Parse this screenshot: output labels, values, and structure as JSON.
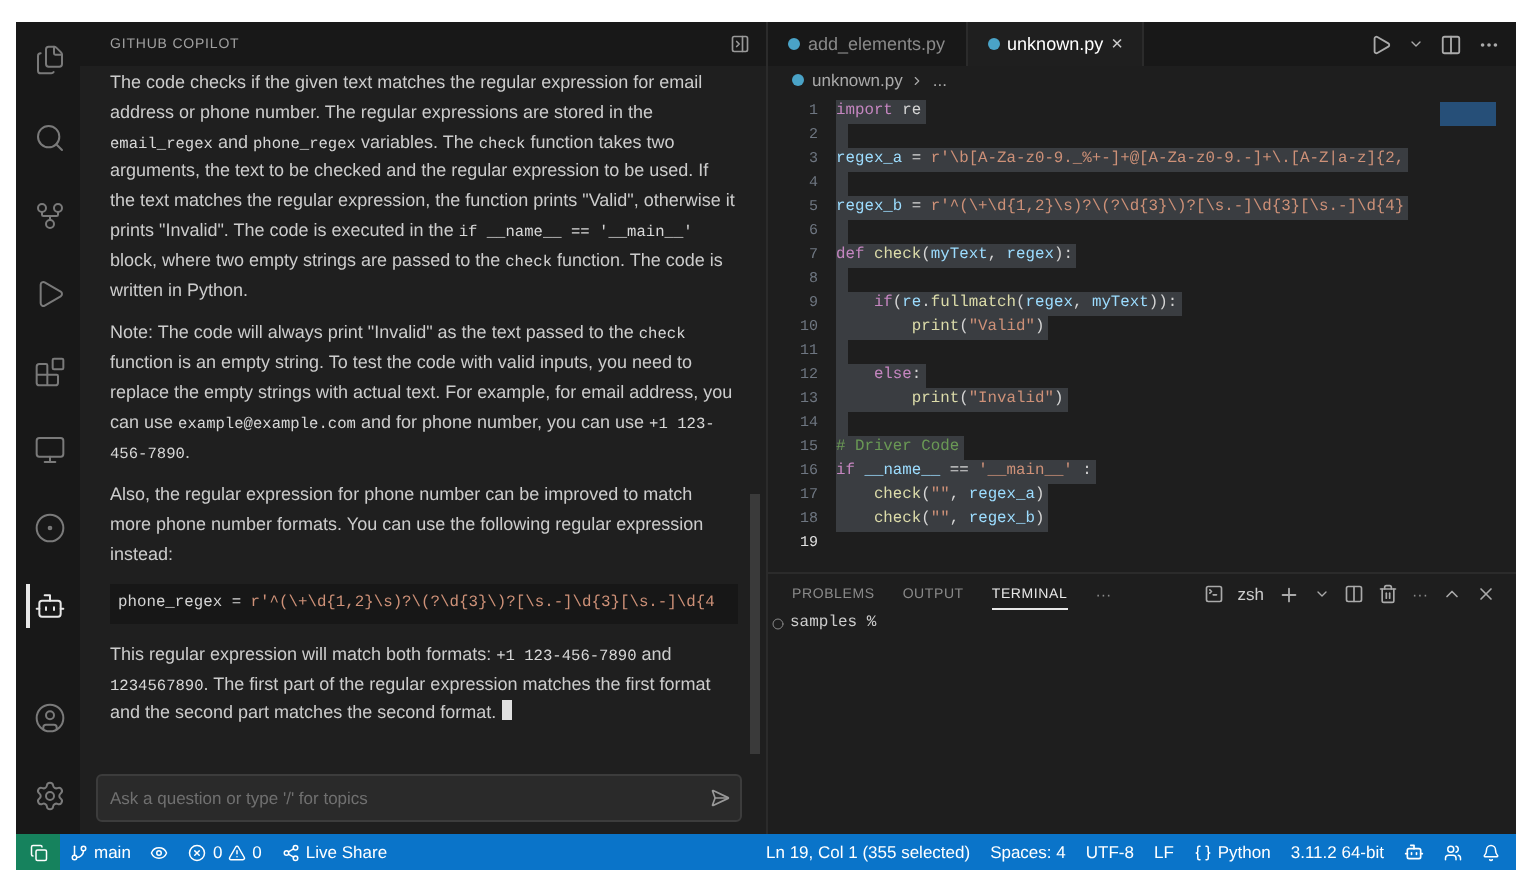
{
  "activity_bar": {
    "items": [
      {
        "kind": "files",
        "selected": false
      },
      {
        "kind": "search",
        "selected": false
      },
      {
        "kind": "source-control",
        "selected": false
      },
      {
        "kind": "run",
        "selected": false
      },
      {
        "kind": "extensions",
        "selected": false
      },
      {
        "kind": "remote",
        "selected": false
      },
      {
        "kind": "copilot",
        "selected": false
      },
      {
        "kind": "chat",
        "selected": true
      }
    ],
    "bottom": [
      {
        "kind": "account"
      },
      {
        "kind": "settings"
      }
    ]
  },
  "chat": {
    "title": "GITHUB COPILOT",
    "paragraphs": [
      {
        "kind": "text",
        "runs": [
          {
            "kind": "text",
            "text": "The code checks if the given text matches the regular expression for email address or phone number. The regular expressions are stored in the "
          },
          {
            "kind": "code",
            "text": "email_regex"
          },
          {
            "kind": "text",
            "text": " and "
          },
          {
            "kind": "code",
            "text": "phone_regex"
          },
          {
            "kind": "text",
            "text": " variables. The "
          },
          {
            "kind": "code",
            "text": "check"
          },
          {
            "kind": "text",
            "text": " function takes two arguments, the text to be checked and the regular expression to be used. If the text matches the regular expression, the function prints \"Valid\", otherwise it prints \"Invalid\". The code is executed in the "
          },
          {
            "kind": "code",
            "text": "if __name__ == '__main__'"
          },
          {
            "kind": "text",
            "text": " block, where two empty strings are passed to the "
          },
          {
            "kind": "code",
            "text": "check"
          },
          {
            "kind": "text",
            "text": " function. The code is written in Python."
          }
        ]
      },
      {
        "kind": "text",
        "runs": [
          {
            "kind": "text",
            "text": "Note: The code will always print \"Invalid\" as the text passed to the "
          },
          {
            "kind": "code",
            "text": "check"
          },
          {
            "kind": "text",
            "text": " function is an empty string. To test the code with valid inputs, you need to replace the empty strings with actual text. For example, for email address, you can use "
          },
          {
            "kind": "code",
            "text": "example@example.com"
          },
          {
            "kind": "text",
            "text": " and for phone number, you can use "
          },
          {
            "kind": "code",
            "text": "+1 123-456-7890"
          },
          {
            "kind": "text",
            "text": "."
          }
        ]
      },
      {
        "kind": "text",
        "runs": [
          {
            "kind": "text",
            "text": "Also, the regular expression for phone number can be improved to match more phone number formats. You can use the following regular expression instead:"
          }
        ]
      },
      {
        "kind": "code",
        "tokens": [
          {
            "kind": "pl",
            "text": "phone_regex = "
          },
          {
            "kind": "str",
            "text": "r'^(\\+\\d{1,2}\\s)?\\(?\\d{3}\\)?[\\s.-]\\d{3}[\\s.-]\\d{4"
          }
        ]
      },
      {
        "kind": "text",
        "cursor": true,
        "runs": [
          {
            "kind": "text",
            "text": "This regular expression will match both formats: "
          },
          {
            "kind": "code",
            "text": "+1 123-456-7890"
          },
          {
            "kind": "text",
            "text": " and "
          },
          {
            "kind": "code",
            "text": "1234567890"
          },
          {
            "kind": "text",
            "text": ". The first part of the regular expression matches the first format and the second part matches the second format."
          }
        ]
      }
    ],
    "input": {
      "placeholder": "Ask a question or type '/' for topics"
    }
  },
  "editor": {
    "tabs": [
      {
        "label": "add_elements.py",
        "selected": false
      },
      {
        "label": "unknown.py",
        "selected": true,
        "close": "×"
      }
    ],
    "breadcrumb": [
      "unknown.py",
      "..."
    ],
    "lines": [
      {
        "number": "1",
        "selected": true,
        "tokens": [
          {
            "kind": "kw",
            "text": "import"
          },
          {
            "kind": "pl",
            "text": " re"
          }
        ]
      },
      {
        "number": "2",
        "selected": true
      },
      {
        "number": "3",
        "selected": true,
        "tokens": [
          {
            "kind": "var",
            "text": "regex_a"
          },
          {
            "kind": "pl",
            "text": " = "
          },
          {
            "kind": "str",
            "text": "r'\\b[A-Za-z0-9._%+-]+@[A-Za-z0-9.-]+\\.[A-Z|a-z]{2,"
          }
        ]
      },
      {
        "number": "4",
        "selected": true
      },
      {
        "number": "5",
        "selected": true,
        "tokens": [
          {
            "kind": "var",
            "text": "regex_b"
          },
          {
            "kind": "pl",
            "text": " = "
          },
          {
            "kind": "str",
            "text": "r'^(\\+\\d{1,2}\\s)?\\(?\\d{3}\\)?[\\s.-]\\d{3}[\\s.-]\\d{4}"
          }
        ]
      },
      {
        "number": "6",
        "selected": true
      },
      {
        "number": "7",
        "selected": true,
        "tokens": [
          {
            "kind": "kw",
            "text": "def "
          },
          {
            "kind": "fn",
            "text": "check"
          },
          {
            "kind": "pl",
            "text": "("
          },
          {
            "kind": "var",
            "text": "myText"
          },
          {
            "kind": "pl",
            "text": ", "
          },
          {
            "kind": "var",
            "text": "regex"
          },
          {
            "kind": "pl",
            "text": "):"
          }
        ]
      },
      {
        "number": "8",
        "selected": true
      },
      {
        "number": "9",
        "selected": true,
        "tokens": [
          {
            "kind": "kw",
            "text": "    if"
          },
          {
            "kind": "pl",
            "text": "("
          },
          {
            "kind": "var",
            "text": "re"
          },
          {
            "kind": "pl",
            "text": "."
          },
          {
            "kind": "fn",
            "text": "fullmatch"
          },
          {
            "kind": "pl",
            "text": "("
          },
          {
            "kind": "var",
            "text": "regex"
          },
          {
            "kind": "pl",
            "text": ", "
          },
          {
            "kind": "var",
            "text": "myText"
          },
          {
            "kind": "pl",
            "text": ")):"
          }
        ]
      },
      {
        "number": "10",
        "selected": true,
        "tokens": [
          {
            "kind": "fn",
            "text": "        print"
          },
          {
            "kind": "pl",
            "text": "("
          },
          {
            "kind": "str",
            "text": "\"Valid\""
          },
          {
            "kind": "pl",
            "text": ")"
          }
        ]
      },
      {
        "number": "11",
        "selected": true
      },
      {
        "number": "12",
        "selected": true,
        "tokens": [
          {
            "kind": "kw",
            "text": "    else"
          },
          {
            "kind": "pl",
            "text": ":"
          }
        ]
      },
      {
        "number": "13",
        "selected": true,
        "tokens": [
          {
            "kind": "fn",
            "text": "        print"
          },
          {
            "kind": "pl",
            "text": "("
          },
          {
            "kind": "str",
            "text": "\"Invalid\""
          },
          {
            "kind": "pl",
            "text": ")"
          }
        ]
      },
      {
        "number": "14",
        "selected": true
      },
      {
        "number": "15",
        "selected": true,
        "tokens": [
          {
            "kind": "cm",
            "text": "# Driver Code"
          }
        ]
      },
      {
        "number": "16",
        "selected": true,
        "tokens": [
          {
            "kind": "kw",
            "text": "if "
          },
          {
            "kind": "var",
            "text": "__name__"
          },
          {
            "kind": "pl",
            "text": " == "
          },
          {
            "kind": "str",
            "text": "'__main__'"
          },
          {
            "kind": "pl",
            "text": " :"
          }
        ]
      },
      {
        "number": "17",
        "selected": true,
        "tokens": [
          {
            "kind": "fn",
            "text": "    check"
          },
          {
            "kind": "pl",
            "text": "("
          },
          {
            "kind": "str",
            "text": "\"\""
          },
          {
            "kind": "pl",
            "text": ", "
          },
          {
            "kind": "var",
            "text": "regex_a"
          },
          {
            "kind": "pl",
            "text": ")"
          }
        ]
      },
      {
        "number": "18",
        "selected": true,
        "tokens": [
          {
            "kind": "fn",
            "text": "    check"
          },
          {
            "kind": "pl",
            "text": "("
          },
          {
            "kind": "str",
            "text": "\"\""
          },
          {
            "kind": "pl",
            "text": ", "
          },
          {
            "kind": "var",
            "text": "regex_b"
          },
          {
            "kind": "pl",
            "text": ")"
          }
        ]
      },
      {
        "number": "19",
        "selected": false
      }
    ]
  },
  "panel": {
    "tabs": [
      {
        "label": "PROBLEMS",
        "selected": false
      },
      {
        "label": "OUTPUT",
        "selected": false
      },
      {
        "label": "TERMINAL",
        "selected": true
      }
    ],
    "more": "···",
    "shell": "zsh",
    "more_actions": "···",
    "terminal_lines": [
      "samples %"
    ]
  },
  "status_bar": {
    "branch": "main",
    "errors": "0",
    "warnings": "0",
    "live_share": "Live Share",
    "right": [
      {
        "kind": "text",
        "text": "Ln 19, Col 1 (355 selected)"
      },
      {
        "kind": "text",
        "text": "Spaces: 4"
      },
      {
        "kind": "text",
        "text": "UTF-8"
      },
      {
        "kind": "text",
        "text": "LF"
      },
      {
        "kind": "language",
        "text": "Python"
      },
      {
        "kind": "text",
        "text": "3.11.2 64-bit"
      }
    ]
  }
}
